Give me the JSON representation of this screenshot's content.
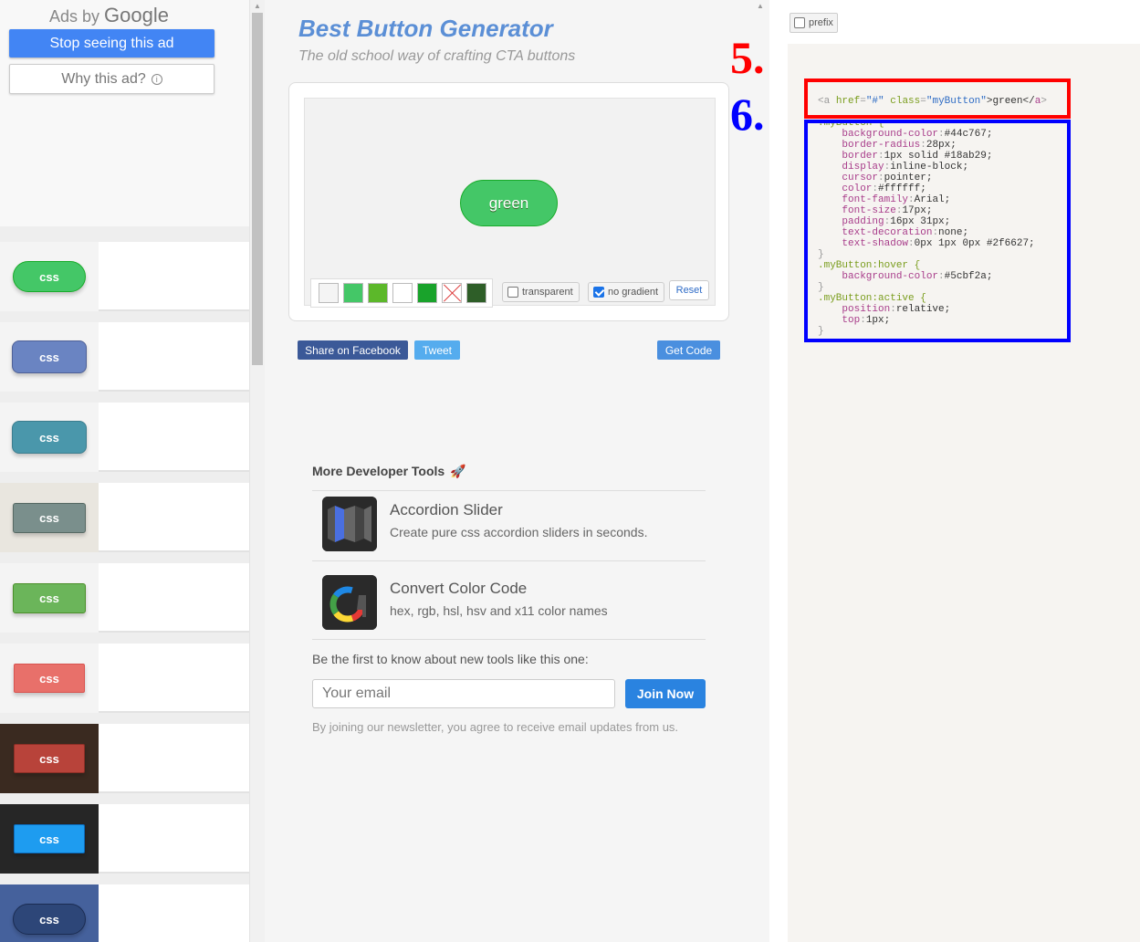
{
  "ad": {
    "ads_by": "Ads by",
    "google": "Google",
    "stop_label": "Stop seeing this ad",
    "why_label": "Why this ad?",
    "info_glyph": "i"
  },
  "gallery": {
    "items": [
      {
        "label": "css",
        "bg": "#f4f4f4",
        "color": "#44c767",
        "border": "#18ab29",
        "shape": "pill"
      },
      {
        "label": "css",
        "bg": "#f4f4f4",
        "color": "#6a84c2",
        "border": "#4e6096",
        "shape": "rounded"
      },
      {
        "label": "css",
        "bg": "#f4f4f4",
        "color": "#4a97ab",
        "border": "#3b7d8e",
        "shape": "rounded"
      },
      {
        "label": "css",
        "bg": "#e9e6df",
        "color": "#7a8f8c",
        "border": "#566963",
        "shape": "square"
      },
      {
        "label": "css",
        "bg": "#f4f4f4",
        "color": "#6bb55a",
        "border": "#4b8f29",
        "shape": "square"
      },
      {
        "label": "css",
        "bg": "#f4f4f4",
        "color": "#e8706a",
        "border": "#d9534f",
        "shape": "flat"
      },
      {
        "label": "css",
        "bg": "#3a2a20",
        "color": "#b8433a",
        "border": "#8c2f26",
        "shape": "flat"
      },
      {
        "label": "css",
        "bg": "#262626",
        "color": "#1e9cf0",
        "border": "#0b6bbd",
        "shape": "flat"
      },
      {
        "label": "css",
        "bg": "#45619c",
        "color": "#2d4678",
        "border": "#1b2c52",
        "shape": "pill"
      }
    ]
  },
  "page": {
    "title": "Best Button Generator",
    "subtitle": "The old school way of crafting CTA buttons"
  },
  "preview": {
    "button_label": "green",
    "button_color": "#44c767",
    "button_border": "#18ab29"
  },
  "swatches": [
    "#f4f4f4",
    "#44c767",
    "#5cb82a",
    "#ffffff",
    "#19a32b",
    "none",
    "#2e5e28"
  ],
  "options": {
    "transparent": "transparent",
    "no_gradient": "no gradient",
    "reset": "Reset"
  },
  "share": {
    "facebook": "Share on Facebook",
    "tweet": "Tweet",
    "get_code": "Get Code"
  },
  "tools": {
    "heading": "More Developer Tools",
    "rocket": "🚀",
    "items": [
      {
        "name": "Accordion Slider",
        "desc": "Create pure css accordion sliders in seconds."
      },
      {
        "name": "Convert Color Code",
        "desc": "hex, rgb, hsl, hsv and x11 color names"
      }
    ]
  },
  "newsletter": {
    "label": "Be the first to know about new tools like this one:",
    "placeholder": "Your email",
    "join": "Join Now",
    "note": "By joining our newsletter, you agree to receive email updates from us."
  },
  "code": {
    "prefix_label": "prefix",
    "html_parts": [
      "<a ",
      "href",
      "=",
      "\"#\"",
      " ",
      "class",
      "=",
      "\"myButton\"",
      ">green</",
      "a",
      ">"
    ],
    "css_lines": [
      {
        "type": "sel",
        "text": ".myButton {"
      },
      {
        "type": "prop",
        "prop": "background-color",
        "val": "#44c767;"
      },
      {
        "type": "prop",
        "prop": "border-radius",
        "val": "28px;"
      },
      {
        "type": "prop",
        "prop": "border",
        "val": "1px solid #18ab29;"
      },
      {
        "type": "prop",
        "prop": "display",
        "val": "inline-block;"
      },
      {
        "type": "prop",
        "prop": "cursor",
        "val": "pointer;"
      },
      {
        "type": "prop",
        "prop": "color",
        "val": "#ffffff;"
      },
      {
        "type": "prop",
        "prop": "font-family",
        "val": "Arial;"
      },
      {
        "type": "prop",
        "prop": "font-size",
        "val": "17px;"
      },
      {
        "type": "prop",
        "prop": "padding",
        "val": "16px 31px;"
      },
      {
        "type": "prop",
        "prop": "text-decoration",
        "val": "none;"
      },
      {
        "type": "prop",
        "prop": "text-shadow",
        "val": "0px 1px 0px #2f6627;"
      },
      {
        "type": "close",
        "text": "}"
      },
      {
        "type": "sel",
        "text": ".myButton:hover {"
      },
      {
        "type": "prop",
        "prop": "background-color",
        "val": "#5cbf2a;"
      },
      {
        "type": "close",
        "text": "}"
      },
      {
        "type": "sel",
        "text": ".myButton:active {"
      },
      {
        "type": "prop",
        "prop": "position",
        "val": "relative;"
      },
      {
        "type": "prop",
        "prop": "top",
        "val": "1px;"
      },
      {
        "type": "close",
        "text": "}"
      }
    ]
  },
  "markers": {
    "five": "5.",
    "six": "6."
  }
}
